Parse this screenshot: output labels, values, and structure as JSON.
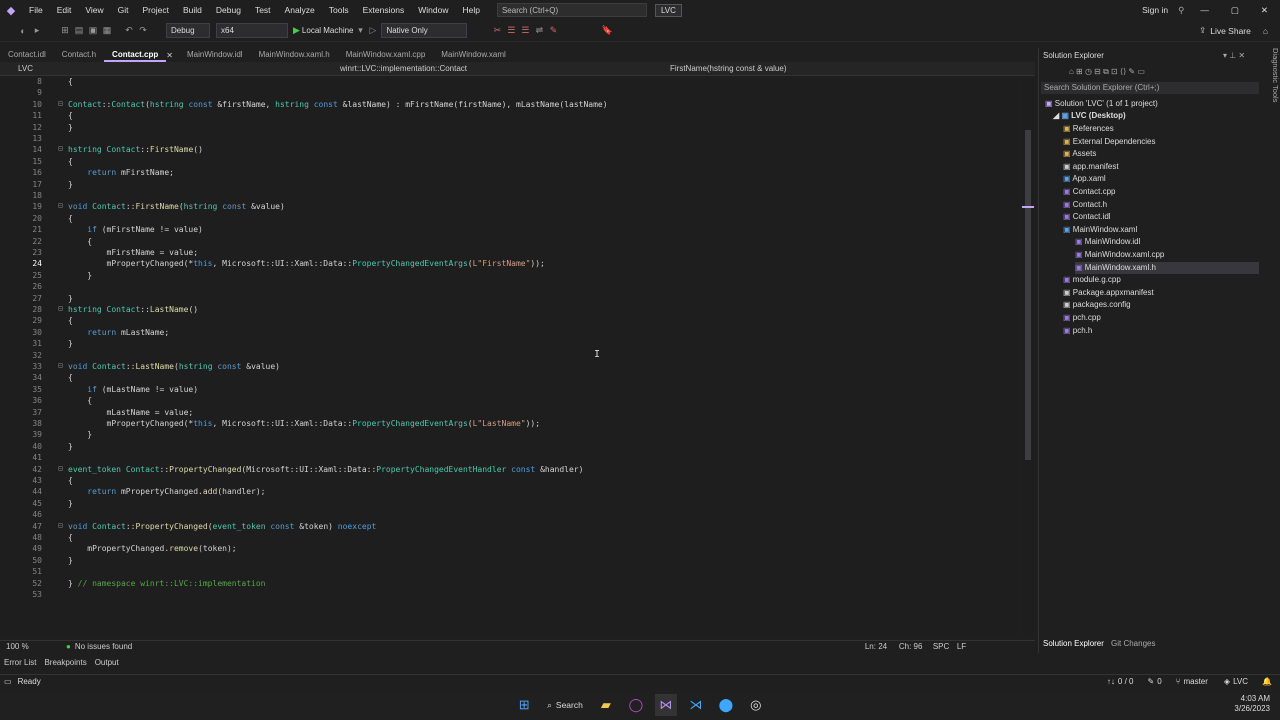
{
  "menubar": {
    "items": [
      "File",
      "Edit",
      "View",
      "Git",
      "Project",
      "Build",
      "Debug",
      "Test",
      "Analyze",
      "Tools",
      "Extensions",
      "Window",
      "Help"
    ],
    "search_placeholder": "Search (Ctrl+Q)",
    "solution_name": "LVC",
    "sign_in": "Sign in"
  },
  "toolbar": {
    "config": "Debug",
    "platform": "x64",
    "run_target": "Local Machine",
    "debug_mode": "Native Only",
    "live_share": "Live Share"
  },
  "tabs": [
    {
      "label": "Contact.idl",
      "active": false
    },
    {
      "label": "Contact.h",
      "active": false
    },
    {
      "label": "Contact.cpp",
      "active": true
    },
    {
      "label": "MainWindow.idl",
      "active": false
    },
    {
      "label": "MainWindow.xaml.h",
      "active": false
    },
    {
      "label": "MainWindow.xaml.cpp",
      "active": false
    },
    {
      "label": "MainWindow.xaml",
      "active": false
    }
  ],
  "navbar": {
    "project": "LVC",
    "scope": "winrt::LVC::implementation::Contact",
    "member": "FirstName(hstring const & value)"
  },
  "code_lines": [
    {
      "n": "8",
      "t": "{"
    },
    {
      "n": "9",
      "t": ""
    },
    {
      "n": "10",
      "t": "Contact::Contact(hstring const &firstName, hstring const &lastName) : mFirstName(firstName), mLastName(lastName)"
    },
    {
      "n": "11",
      "t": "{"
    },
    {
      "n": "12",
      "t": "}"
    },
    {
      "n": "13",
      "t": ""
    },
    {
      "n": "14",
      "t": "hstring Contact::FirstName()"
    },
    {
      "n": "15",
      "t": "{"
    },
    {
      "n": "16",
      "t": "    return mFirstName;"
    },
    {
      "n": "17",
      "t": "}"
    },
    {
      "n": "18",
      "t": ""
    },
    {
      "n": "19",
      "t": "void Contact::FirstName(hstring const &value)"
    },
    {
      "n": "20",
      "t": "{"
    },
    {
      "n": "21",
      "t": "    if (mFirstName != value)"
    },
    {
      "n": "22",
      "t": "    {"
    },
    {
      "n": "23",
      "t": "        mFirstName = value;"
    },
    {
      "n": "24",
      "t": "        mPropertyChanged(*this, Microsoft::UI::Xaml::Data::PropertyChangedEventArgs(L\"FirstName\"));"
    },
    {
      "n": "25",
      "t": "    }"
    },
    {
      "n": "26",
      "t": ""
    },
    {
      "n": "27",
      "t": "}"
    },
    {
      "n": "28",
      "t": "hstring Contact::LastName()"
    },
    {
      "n": "29",
      "t": "{"
    },
    {
      "n": "30",
      "t": "    return mLastName;"
    },
    {
      "n": "31",
      "t": "}"
    },
    {
      "n": "32",
      "t": ""
    },
    {
      "n": "33",
      "t": "void Contact::LastName(hstring const &value)"
    },
    {
      "n": "34",
      "t": "{"
    },
    {
      "n": "35",
      "t": "    if (mLastName != value)"
    },
    {
      "n": "36",
      "t": "    {"
    },
    {
      "n": "37",
      "t": "        mLastName = value;"
    },
    {
      "n": "38",
      "t": "        mPropertyChanged(*this, Microsoft::UI::Xaml::Data::PropertyChangedEventArgs(L\"LastName\"));"
    },
    {
      "n": "39",
      "t": "    }"
    },
    {
      "n": "40",
      "t": "}"
    },
    {
      "n": "41",
      "t": ""
    },
    {
      "n": "42",
      "t": "event_token Contact::PropertyChanged(Microsoft::UI::Xaml::Data::PropertyChangedEventHandler const &handler)"
    },
    {
      "n": "43",
      "t": "{"
    },
    {
      "n": "44",
      "t": "    return mPropertyChanged.add(handler);"
    },
    {
      "n": "45",
      "t": "}"
    },
    {
      "n": "46",
      "t": ""
    },
    {
      "n": "47",
      "t": "void Contact::PropertyChanged(event_token const &token) noexcept"
    },
    {
      "n": "48",
      "t": "{"
    },
    {
      "n": "49",
      "t": "    mPropertyChanged.remove(token);"
    },
    {
      "n": "50",
      "t": "}"
    },
    {
      "n": "51",
      "t": ""
    },
    {
      "n": "52",
      "t": "} // namespace winrt::LVC::implementation"
    },
    {
      "n": "53",
      "t": ""
    }
  ],
  "current_line": "24",
  "editor_status": {
    "zoom": "100 %",
    "issues": "No issues found",
    "line": "Ln: 24",
    "col": "Ch: 96",
    "spc": "SPC",
    "lf": "LF"
  },
  "bottom_tabs": [
    "Error List",
    "Breakpoints",
    "Output"
  ],
  "solution_explorer": {
    "title": "Solution Explorer",
    "search_placeholder": "Search Solution Explorer (Ctrl+;)",
    "solution": "Solution 'LVC' (1 of 1 project)",
    "project": "LVC (Desktop)",
    "items": [
      {
        "label": "References",
        "level": 2
      },
      {
        "label": "External Dependencies",
        "level": 2
      },
      {
        "label": "Assets",
        "level": 2
      },
      {
        "label": "app.manifest",
        "level": 2
      },
      {
        "label": "App.xaml",
        "level": 2
      },
      {
        "label": "Contact.cpp",
        "level": 2
      },
      {
        "label": "Contact.h",
        "level": 2
      },
      {
        "label": "Contact.idl",
        "level": 2
      },
      {
        "label": "MainWindow.xaml",
        "level": 2
      },
      {
        "label": "MainWindow.idl",
        "level": 3
      },
      {
        "label": "MainWindow.xaml.cpp",
        "level": 3
      },
      {
        "label": "MainWindow.xaml.h",
        "level": 3
      },
      {
        "label": "module.g.cpp",
        "level": 2
      },
      {
        "label": "Package.appxmanifest",
        "level": 2
      },
      {
        "label": "packages.config",
        "level": 2
      },
      {
        "label": "pch.cpp",
        "level": 2
      },
      {
        "label": "pch.h",
        "level": 2
      }
    ],
    "selected": "MainWindow.xaml.h",
    "tabs": [
      "Solution Explorer",
      "Git Changes"
    ]
  },
  "side_label": "Diagnostic Tools",
  "statusbar": {
    "ready": "Ready",
    "changes": "0 / 0",
    "edits": "0",
    "branch": "master",
    "repo": "LVC"
  },
  "taskbar": {
    "search": "Search",
    "time": "4:03 AM",
    "date": "3/26/2023"
  }
}
